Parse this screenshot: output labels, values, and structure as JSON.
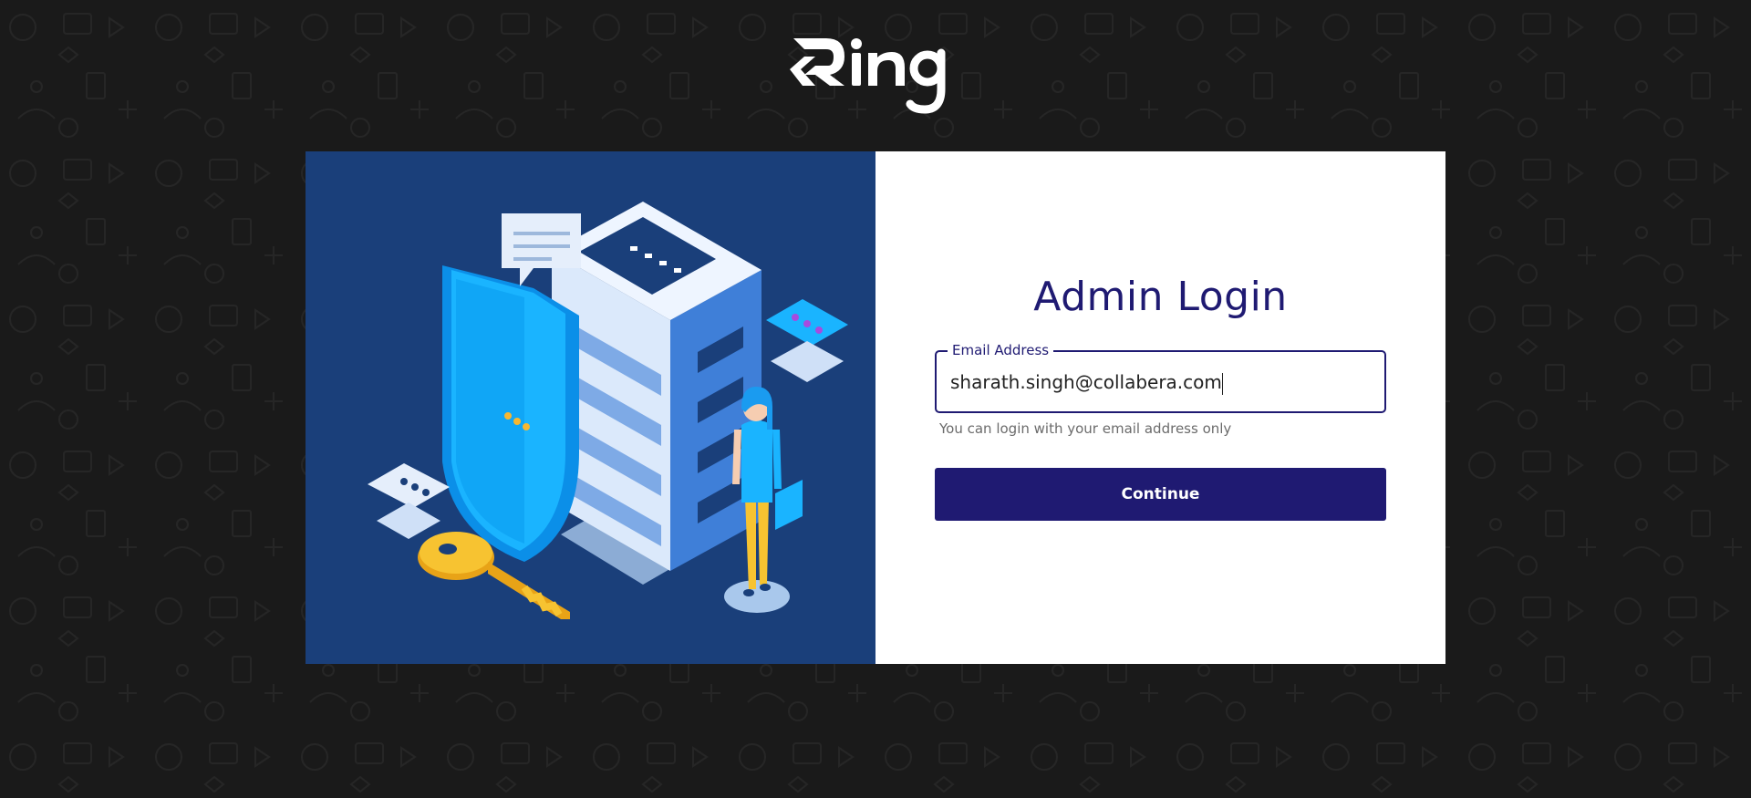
{
  "brand": {
    "logo_text": "Ring"
  },
  "login": {
    "title": "Admin Login",
    "email_label": "Email Address",
    "email_value": "sharath.singh@collabera.com",
    "helper_text": "You can login with your email address only",
    "continue_label": "Continue"
  },
  "colors": {
    "page_background": "#1a1a1a",
    "illustration_background": "#1a3f7a",
    "primary": "#1f1a72",
    "panel_background": "#ffffff"
  },
  "icons": {
    "illustration": "security-server-illustration"
  }
}
